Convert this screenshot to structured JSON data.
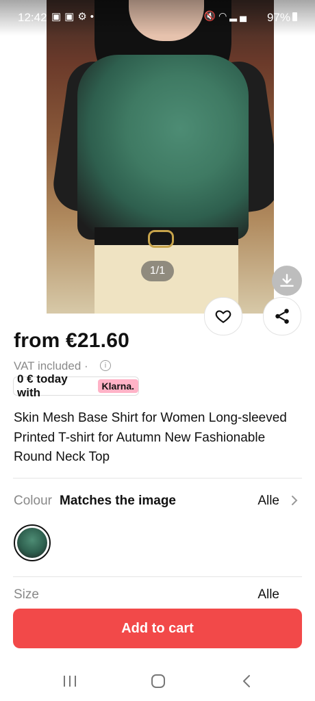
{
  "status_bar": {
    "time": "12:42",
    "battery": "97%"
  },
  "gallery": {
    "counter": "1/1"
  },
  "product": {
    "price": "from €21.60",
    "vat": "VAT included",
    "klarna_text": "0 € today with",
    "klarna_brand": "Klarna.",
    "title": "Skin Mesh Base Shirt for Women Long-sleeved Printed T-shirt for Autumn New Fashionable Round Neck Top"
  },
  "colour": {
    "label": "Colour",
    "value": "Matches the image",
    "all_link": "Alle"
  },
  "size": {
    "label": "Size",
    "all_link": "Alle"
  },
  "actions": {
    "add_to_cart": "Add to cart"
  },
  "icons": [
    "back-arrow-icon",
    "search-icon",
    "download-icon",
    "heart-icon",
    "share-icon",
    "info-icon",
    "chevron-right-icon"
  ],
  "colors": {
    "accent": "#f24949",
    "klarna_pink": "#ffb3c7"
  }
}
